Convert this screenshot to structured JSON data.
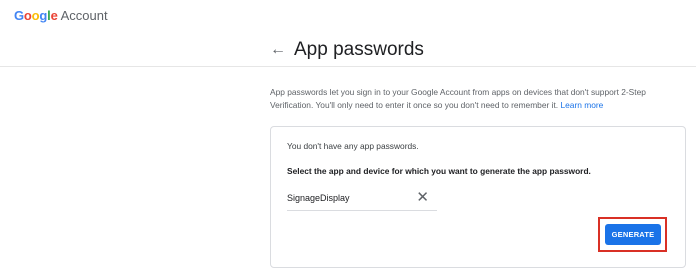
{
  "header": {
    "logo_letters": [
      {
        "char": "G",
        "color": "#4285F4"
      },
      {
        "char": "o",
        "color": "#EA4335"
      },
      {
        "char": "o",
        "color": "#FBBC05"
      },
      {
        "char": "g",
        "color": "#4285F4"
      },
      {
        "char": "l",
        "color": "#34A853"
      },
      {
        "char": "e",
        "color": "#EA4335"
      }
    ],
    "product": "Account"
  },
  "page": {
    "back_icon": "arrow-back-icon",
    "back_glyph": "←",
    "title": "App passwords"
  },
  "description": {
    "text": "App passwords let you sign in to your Google Account from apps on devices that don't support 2-Step Verification. You'll only need to enter it once so you don't need to remember it.",
    "link_text": "Learn more"
  },
  "card": {
    "empty_message": "You don't have any app passwords.",
    "instruction": "Select the app and device for which you want to generate the app password.",
    "app_field": {
      "value": "SignageDisplay",
      "clear_icon": "close-icon",
      "clear_glyph": "✕"
    },
    "generate_label": "GENERATE"
  },
  "colors": {
    "accent": "#1a73e8",
    "highlight": "#d93025"
  }
}
